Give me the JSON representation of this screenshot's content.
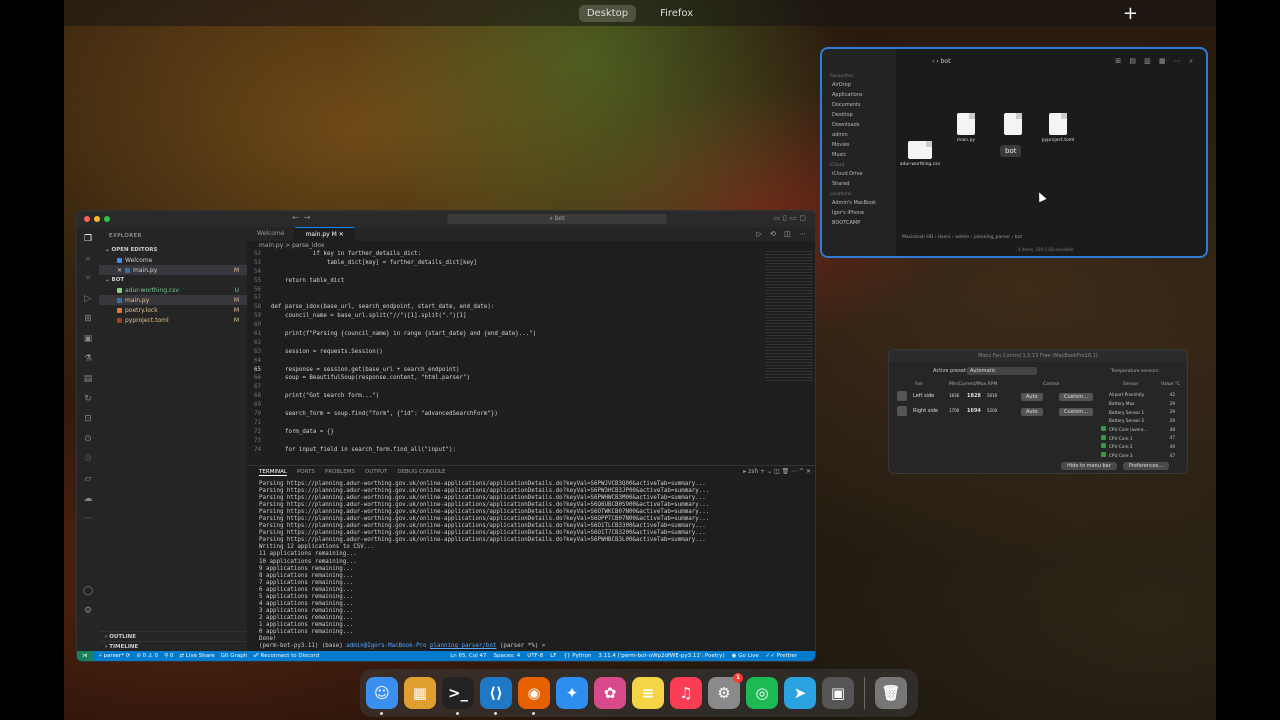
{
  "mission_control": {
    "spaces": [
      "Desktop",
      "Firefox"
    ],
    "add": "+"
  },
  "vscode": {
    "search": "bot",
    "explorer": {
      "title": "EXPLORER",
      "open_editors_title": "OPEN EDITORS",
      "open_editors": [
        {
          "name": "Welcome",
          "badge": ""
        },
        {
          "name": "main.py",
          "badge": "M"
        }
      ],
      "folder_title": "BOT",
      "files": [
        {
          "name": "adur-worthing.csv",
          "badge": "U"
        },
        {
          "name": "main.py",
          "badge": "M"
        },
        {
          "name": "poetry.lock",
          "badge": "M"
        },
        {
          "name": "pyproject.toml",
          "badge": "M"
        }
      ],
      "outline": "OUTLINE",
      "timeline": "TIMELINE"
    },
    "tabs": [
      "Welcome",
      "main.py M"
    ],
    "breadcrumb": "main.py > parse_idox",
    "code": [
      {
        "ln": "52",
        "text": "            if key in further_details_dict:"
      },
      {
        "ln": "53",
        "text": "                table_dict[key] = further_details_dict[key]"
      },
      {
        "ln": "54",
        "text": ""
      },
      {
        "ln": "55",
        "text": "    return table_dict"
      },
      {
        "ln": "56",
        "text": ""
      },
      {
        "ln": "57",
        "text": ""
      },
      {
        "ln": "58",
        "text": "def parse_idox(base_url, search_endpoint, start_date, end_date):"
      },
      {
        "ln": "59",
        "text": "    council_name = base_url.split(\"//\")[1].split(\".\")[1]"
      },
      {
        "ln": "60",
        "text": ""
      },
      {
        "ln": "61",
        "text": "    print(f\"Parsing {council_name} in range {start_date} and {end_date}...\")"
      },
      {
        "ln": "62",
        "text": ""
      },
      {
        "ln": "63",
        "text": "    session = requests.Session()"
      },
      {
        "ln": "64",
        "text": ""
      },
      {
        "ln": "65",
        "text": "    response = session.get(base_url + search_endpoint)"
      },
      {
        "ln": "66",
        "text": "    soup = BeautifulSoup(response.content, \"html.parser\")"
      },
      {
        "ln": "67",
        "text": ""
      },
      {
        "ln": "68",
        "text": "    print(\"Got search form...\")"
      },
      {
        "ln": "69",
        "text": ""
      },
      {
        "ln": "70",
        "text": "    search_form = soup.find(\"form\", {\"id\": \"advancedSearchForm\"})"
      },
      {
        "ln": "71",
        "text": ""
      },
      {
        "ln": "72",
        "text": "    form_data = {}"
      },
      {
        "ln": "73",
        "text": ""
      },
      {
        "ln": "74",
        "text": "    for input_field in search_form.find_all(\"input\"):"
      }
    ],
    "terminal_tabs": [
      "TERMINAL",
      "PORTS",
      "PROBLEMS",
      "OUTPUT",
      "DEBUG CONSOLE"
    ],
    "terminal_shell": "zsh",
    "terminal_lines": [
      "Parsing https://planning.adur-worthing.gov.uk/online-applications/applicationDetails.do?keyVal=S6PWJVCB3Q00&activeTab=summary...",
      "Parsing https://planning.adur-worthing.gov.uk/online-applications/applicationDetails.do?keyVal=S6PW3HCB3JP00&activeTab=summary...",
      "Parsing https://planning.adur-worthing.gov.uk/online-applications/applicationDetails.do?keyVal=S6PWHWCB3M00&activeTab=summary...",
      "Parsing https://planning.adur-worthing.gov.uk/online-applications/applicationDetails.do?keyVal=S6Q6UBCB0S900&activeTab=summary...",
      "Parsing https://planning.adur-worthing.gov.uk/online-applications/applicationDetails.do?keyVal=S6OTWKCB07N00&activeTab=summary...",
      "Parsing https://planning.adur-worthing.gov.uk/online-applications/applicationDetails.do?keyVal=S6OPPTCB07N00&activeTab=summary...",
      "Parsing https://planning.adur-worthing.gov.uk/online-applications/applicationDetails.do?keyVal=S6O1TLCB3300&activeTab=summary...",
      "Parsing https://planning.adur-worthing.gov.uk/online-applications/applicationDetails.do?keyVal=S6O1T7CB3200&activeTab=summary...",
      "Parsing https://planning.adur-worthing.gov.uk/online-applications/applicationDetails.do?keyVal=S6PWHBCB3L00&activeTab=summary...",
      "Writing 12 applications to CSV...",
      "11 applications remaining...",
      "10 applications remaining...",
      "9 applications remaining...",
      "8 applications remaining...",
      "7 applications remaining...",
      "6 applications remaining...",
      "5 applications remaining...",
      "4 applications remaining...",
      "3 applications remaining...",
      "2 applications remaining...",
      "1 applications remaining...",
      "0 applications remaining...",
      "Done!"
    ],
    "prompt": {
      "env": "(perm-bot-py3.11) (base) ",
      "user": "admin@Igors-MacBook-Pro",
      "path": "planning_parser/bot",
      "git": " (parser *%) » "
    },
    "status": {
      "branch": "parser*",
      "errors": "⊘ 0 ⚠ 0",
      "ports": "⚲ 0",
      "live_share": "Live Share",
      "git_graph": "Git Graph",
      "discord": "Reconnect to Discord",
      "position": "Ln 65, Col 47",
      "spaces": "Spaces: 4",
      "encoding": "UTF-8",
      "eol": "LF",
      "language": "Python",
      "interpreter": "3.11.4 ('perm-bot-oWp2dfWE-py3.11': Poetry)",
      "golive": "Go Live",
      "prettier": "Prettier"
    }
  },
  "finder": {
    "title": "bot",
    "sidebar": [
      {
        "h": "Favourites",
        "items": [
          "AirDrop",
          "Applications",
          "Documents",
          "Desktop",
          "Downloads",
          "admin",
          "Movies",
          "Music"
        ]
      },
      {
        "h": "iCloud",
        "items": [
          "iCloud Drive",
          "Shared"
        ]
      },
      {
        "h": "Locations",
        "items": [
          "Admin's MacBook",
          "Igor's iPhone",
          "BOOTCAMP"
        ]
      }
    ],
    "files": [
      "main.py",
      "poetry.lock",
      "pyproject.toml",
      "adur-worthing.csv"
    ],
    "tooltip": "bot",
    "path": "Macintosh HD › Users › admin › planning_parser › bot",
    "status": "4 items, 180.5 GB available"
  },
  "fan_control": {
    "title": "Macs Fan Control 1.5.15 Free (MacBookPro18,1)",
    "preset_label": "Active preset:",
    "preset_value": "Automatic",
    "headers": {
      "fan": "Fan",
      "rpm": "Min/Current/Max RPM",
      "control": "Control",
      "sensor": "Sensor",
      "value": "Value °C",
      "temp": "Temperature sensors:"
    },
    "fans": [
      {
        "name": "Left side",
        "min": "1836",
        "cur": "1828",
        "max": "5616",
        "mode": "Auto",
        "custom": "Custom..."
      },
      {
        "name": "Right side",
        "min": "1700",
        "cur": "1694",
        "max": "5200",
        "mode": "Auto",
        "custom": "Custom..."
      }
    ],
    "sensors": [
      {
        "name": "Airport Proximity",
        "value": "42"
      },
      {
        "name": "Battery Max",
        "value": "29"
      },
      {
        "name": "Battery Sensor 1",
        "value": "29"
      },
      {
        "name": "Battery Sensor 2",
        "value": "29"
      },
      {
        "name": "CPU Core (avera...",
        "value": "48"
      },
      {
        "name": "CPU Core 1",
        "value": "47"
      },
      {
        "name": "CPU Core 2",
        "value": "49"
      },
      {
        "name": "CPU Core 3",
        "value": "47"
      }
    ],
    "hide_btn": "Hide to menu bar",
    "prefs_btn": "Preferences..."
  },
  "dock": {
    "apps": [
      {
        "name": "finder",
        "glyph": "☺",
        "color": "#3b8ff0"
      },
      {
        "name": "launchpad",
        "glyph": "▦",
        "color": "#e0a030"
      },
      {
        "name": "terminal",
        "glyph": ">_",
        "color": "#222222"
      },
      {
        "name": "vscode",
        "glyph": "⟨⟩",
        "color": "#1f79c4"
      },
      {
        "name": "firefox",
        "glyph": "◉",
        "color": "#e66000"
      },
      {
        "name": "safari",
        "glyph": "✦",
        "color": "#2d8ef0"
      },
      {
        "name": "photos",
        "glyph": "✿",
        "color": "#d84b8a"
      },
      {
        "name": "notes",
        "glyph": "≡",
        "color": "#f5d547"
      },
      {
        "name": "music",
        "glyph": "♫",
        "color": "#fa3c54"
      },
      {
        "name": "system-settings",
        "glyph": "⚙",
        "color": "#8a8a8a",
        "badge": "1"
      },
      {
        "name": "spotify",
        "glyph": "◎",
        "color": "#1db954"
      },
      {
        "name": "telegram",
        "glyph": "➤",
        "color": "#2aa3e0"
      },
      {
        "name": "screenshot",
        "glyph": "▣",
        "color": "#555555"
      }
    ],
    "trash": {
      "name": "trash",
      "glyph": "🗑",
      "color": "#777777"
    }
  }
}
